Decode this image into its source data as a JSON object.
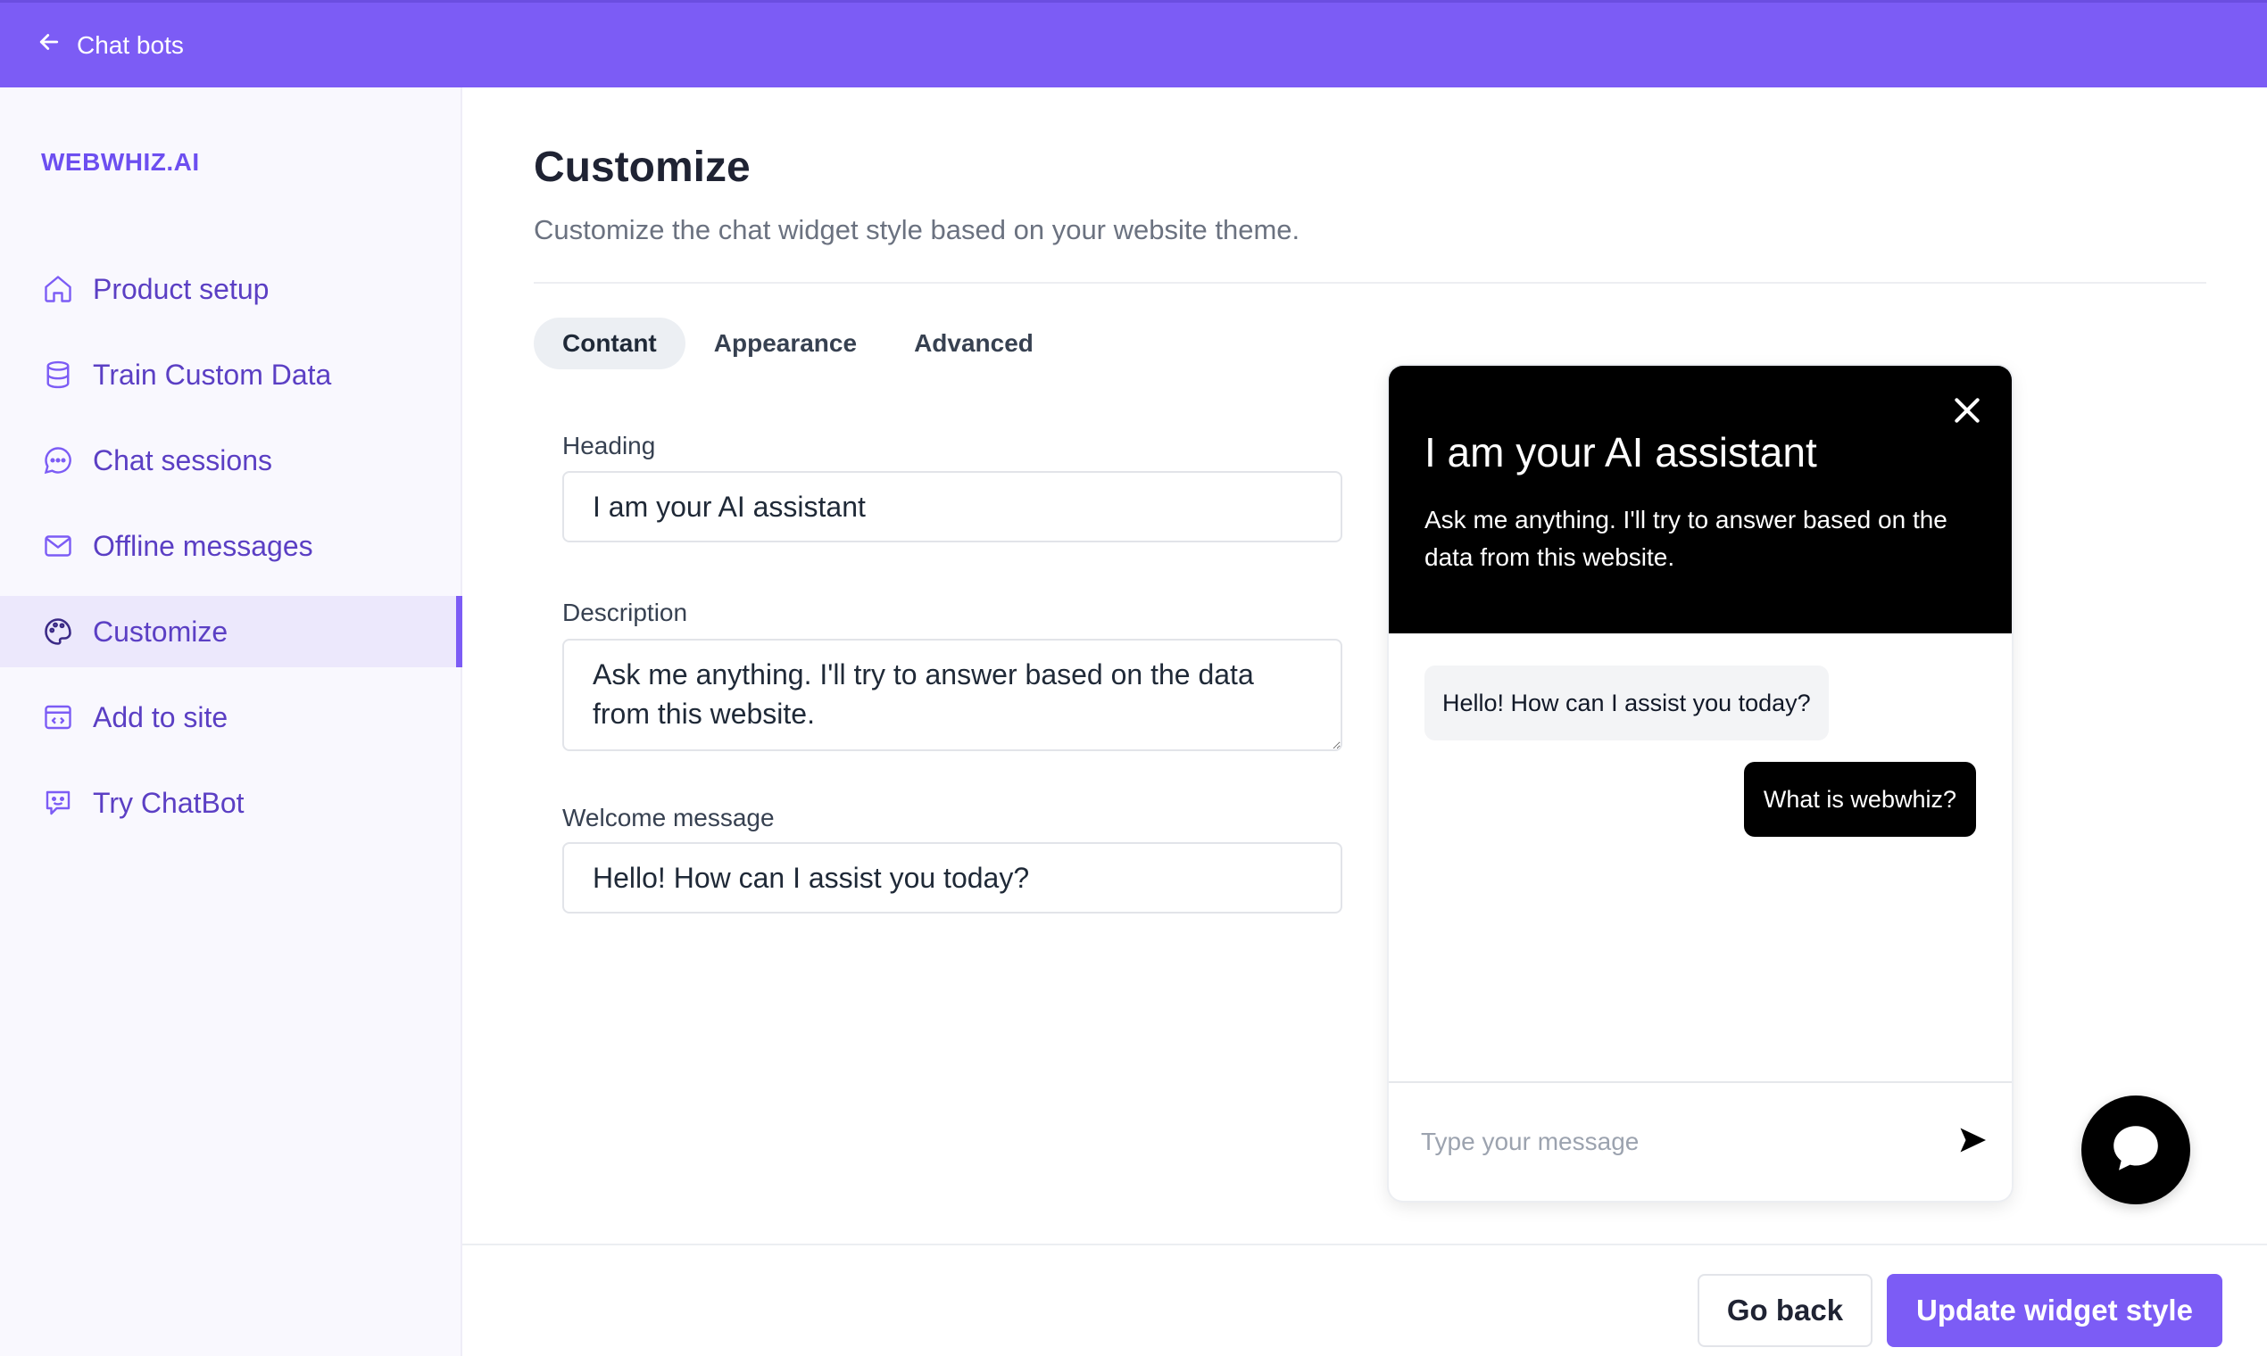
{
  "topbar": {
    "back_label": "Chat bots",
    "back_icon": "arrow-left-icon",
    "color": "#7c5cf5"
  },
  "sidebar": {
    "brand": "WEBWHIZ.AI",
    "items": [
      {
        "label": "Product setup",
        "icon": "home-icon",
        "active": false
      },
      {
        "label": "Train Custom Data",
        "icon": "database-icon",
        "active": false
      },
      {
        "label": "Chat sessions",
        "icon": "chat-dots-icon",
        "active": false
      },
      {
        "label": "Offline messages",
        "icon": "mail-icon",
        "active": false
      },
      {
        "label": "Customize",
        "icon": "palette-icon",
        "active": true
      },
      {
        "label": "Add to site",
        "icon": "code-window-icon",
        "active": false
      },
      {
        "label": "Try ChatBot",
        "icon": "bot-face-icon",
        "active": false
      }
    ]
  },
  "main": {
    "title": "Customize",
    "subtitle": "Customize the chat widget style based on your website theme.",
    "tabs": [
      {
        "label": "Contant",
        "active": true
      },
      {
        "label": "Appearance",
        "active": false
      },
      {
        "label": "Advanced",
        "active": false
      }
    ],
    "form": {
      "heading_label": "Heading",
      "heading_value": "I am your AI assistant",
      "description_label": "Description",
      "description_value": "Ask me anything. I'll try to answer based on the data from this website.",
      "welcome_label": "Welcome message",
      "welcome_value": "Hello! How can I assist you today?"
    }
  },
  "preview": {
    "heading": "I am your AI assistant",
    "description": "Ask me anything. I'll try to answer based on the data from this website.",
    "bot_message": "Hello! How can I assist you today?",
    "user_message": "What is webwhiz?",
    "input_placeholder": "Type your message",
    "header_color": "#000000"
  },
  "actions": {
    "go_back": "Go back",
    "update": "Update widget style"
  }
}
